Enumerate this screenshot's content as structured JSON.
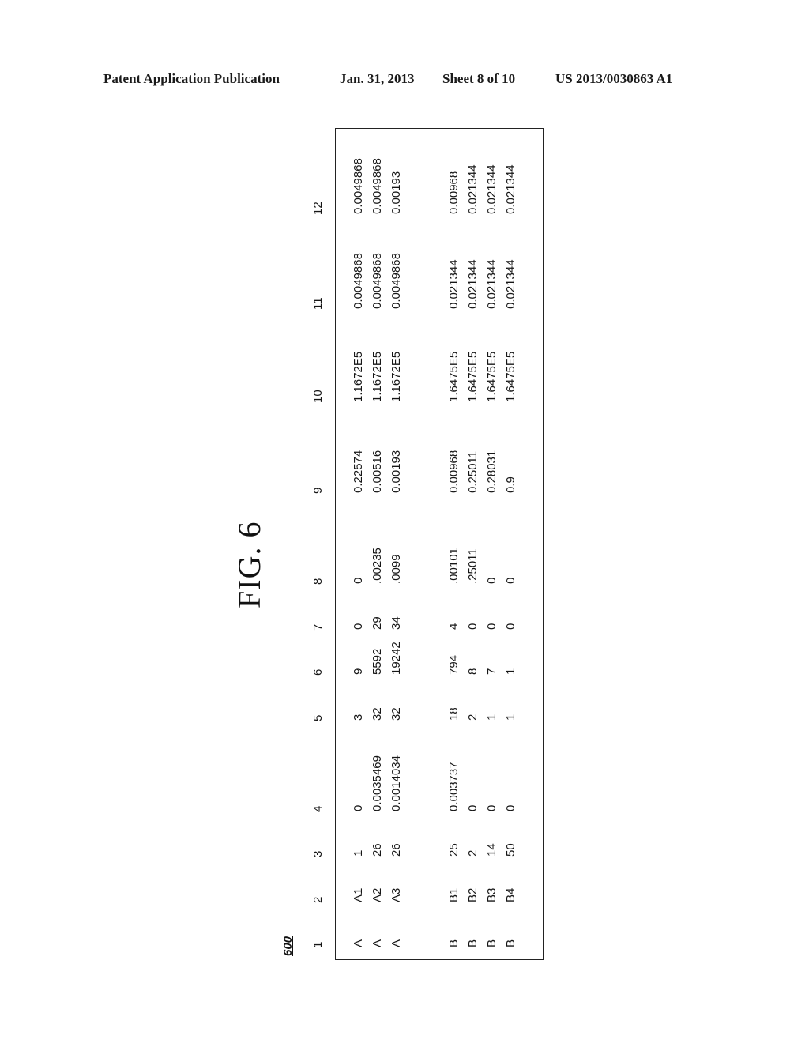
{
  "header": {
    "publication_type": "Patent Application Publication",
    "date": "Jan. 31, 2013",
    "sheet": "Sheet 8 of 10",
    "publication_number": "US 2013/0030863 A1"
  },
  "figure": {
    "label": "FIG. 6",
    "reference_numeral": "600"
  },
  "table": {
    "columns": [
      "1",
      "2",
      "3",
      "4",
      "5",
      "6",
      "7",
      "8",
      "9",
      "10",
      "11",
      "12"
    ],
    "groups": [
      {
        "name": "A",
        "rows": [
          [
            "A",
            "A1",
            "1",
            "0",
            "3",
            "9",
            "0",
            "0",
            "0.22574",
            "1.1672E5",
            "0.0049868",
            "0.0049868"
          ],
          [
            "A",
            "A2",
            "26",
            "0.0035469",
            "32",
            "5592",
            "29",
            ".00235",
            "0.00516",
            "1.1672E5",
            "0.0049868",
            "0.0049868"
          ],
          [
            "A",
            "A3",
            "26",
            "0.0014034",
            "32",
            "19242",
            "34",
            ".0099",
            "0.00193",
            "1.1672E5",
            "0.0049868",
            "0.00193"
          ]
        ]
      },
      {
        "name": "B",
        "rows": [
          [
            "B",
            "B1",
            "25",
            "0.003737",
            "18",
            "794",
            "4",
            ".00101",
            "0.00968",
            "1.6475E5",
            "0.021344",
            "0.00968"
          ],
          [
            "B",
            "B2",
            "2",
            "0",
            "2",
            "8",
            "0",
            ".25011",
            "0.25011",
            "1.6475E5",
            "0.021344",
            "0.021344"
          ],
          [
            "B",
            "B3",
            "14",
            "0",
            "1",
            "7",
            "0",
            "0",
            "0.28031",
            "1.6475E5",
            "0.021344",
            "0.021344"
          ],
          [
            "B",
            "B4",
            "50",
            "0",
            "1",
            "1",
            "0",
            "0",
            "0.9",
            "1.6475E5",
            "0.021344",
            "0.021344"
          ]
        ]
      }
    ]
  }
}
